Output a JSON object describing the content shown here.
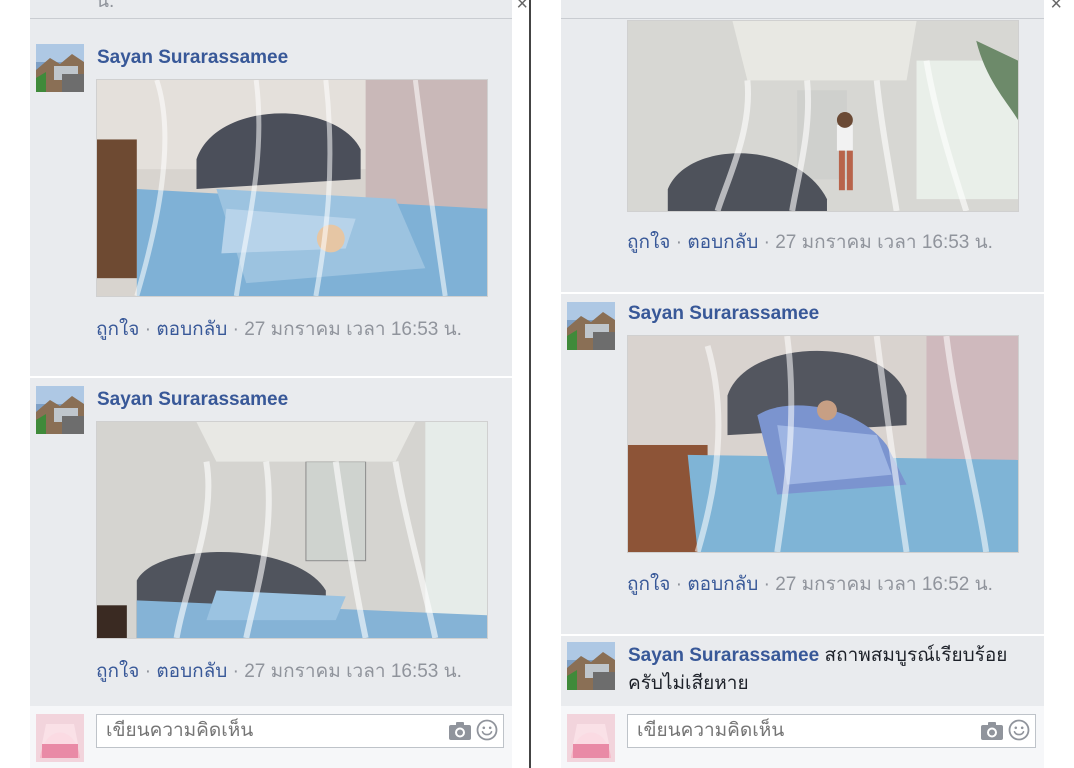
{
  "left_panel": {
    "close_glyph": "×",
    "top_fragment": "น.",
    "comments": [
      {
        "author": "Sayan Surarassamee",
        "photo": "photo-bed-under-net-with-blanket",
        "like": "ถูกใจ",
        "reply": "ตอบกลับ",
        "sep": "·",
        "timestamp": "27 มกราคม เวลา 16:53 น."
      },
      {
        "author": "Sayan Surarassamee",
        "photo": "photo-bed-under-canopy-net",
        "like": "ถูกใจ",
        "reply": "ตอบกลับ",
        "sep": "·",
        "timestamp": "27 มกราคม เวลา 16:53 น."
      }
    ],
    "composer": {
      "placeholder": "เขียนความคิดเห็น",
      "camera_icon": "camera-icon",
      "smiley_icon": "smiley-icon"
    }
  },
  "right_panel": {
    "close_glyph": "×",
    "top_comment": {
      "photo": "photo-child-beside-canopy-net",
      "like": "ถูกใจ",
      "reply": "ตอบกลับ",
      "sep": "·",
      "timestamp": "27 มกราคม เวลา 16:53 น."
    },
    "comments": [
      {
        "author": "Sayan Surarassamee",
        "photo": "photo-child-in-bed-with-blanket",
        "like": "ถูกใจ",
        "reply": "ตอบกลับ",
        "sep": "·",
        "timestamp": "27 มกราคม เวลา 16:52 น."
      },
      {
        "author": "Sayan Surarassamee",
        "text": "สถาพสมบูรณ์เรียบร้อยครับไม่เสียหาย"
      }
    ],
    "composer": {
      "placeholder": "เขียนความคิดเห็น",
      "camera_icon": "camera-icon",
      "smiley_icon": "smiley-icon"
    }
  },
  "colors": {
    "thread_bg": "#e9ebee",
    "author_blue": "#385898",
    "meta_gray": "#90949c"
  }
}
